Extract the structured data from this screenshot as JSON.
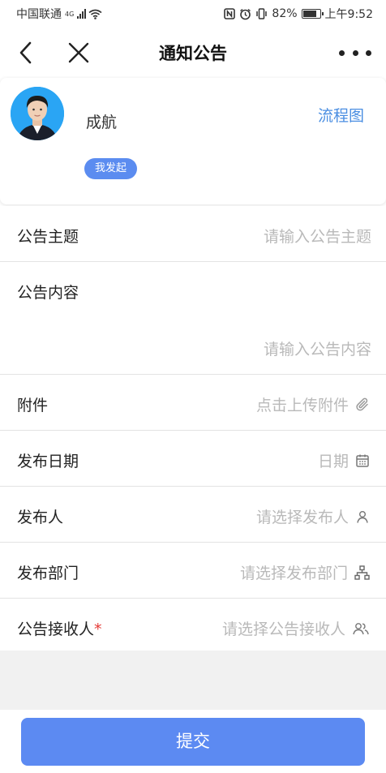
{
  "status_bar": {
    "carrier": "中国联通",
    "network": "4G",
    "battery_percent": "82%",
    "battery_level": 0.82,
    "time": "上午9:52",
    "icons": [
      "signal-icon",
      "wifi-icon",
      "nfc-icon",
      "alarm-icon",
      "vibrate-icon",
      "battery-icon"
    ]
  },
  "nav": {
    "title": "通知公告",
    "back_icon": "chevron-left-icon",
    "close_icon": "close-icon",
    "more_icon": "more-icon"
  },
  "applicant": {
    "name": "成航",
    "badge": "我发起",
    "flow_link": "流程图"
  },
  "form": {
    "fields": [
      {
        "label": "公告主题",
        "placeholder": "请输入公告主题",
        "icon": null
      },
      {
        "label": "公告内容",
        "placeholder": "请输入公告内容",
        "icon": null
      },
      {
        "label": "附件",
        "placeholder": "点击上传附件",
        "icon": "paperclip-icon"
      },
      {
        "label": "发布日期",
        "placeholder": "日期",
        "icon": "calendar-icon"
      },
      {
        "label": "发布人",
        "placeholder": "请选择发布人",
        "icon": "person-icon"
      },
      {
        "label": "发布部门",
        "placeholder": "请选择发布部门",
        "icon": "org-chart-icon"
      },
      {
        "label": "公告接收人",
        "required_mark": "*",
        "placeholder": "请选择公告接收人",
        "icon": "people-icon"
      }
    ]
  },
  "footer": {
    "submit_label": "提交"
  },
  "colors": {
    "accent": "#5c8af2",
    "link": "#4a8ee2",
    "required": "#e53935",
    "placeholder": "#b9b9b9"
  }
}
